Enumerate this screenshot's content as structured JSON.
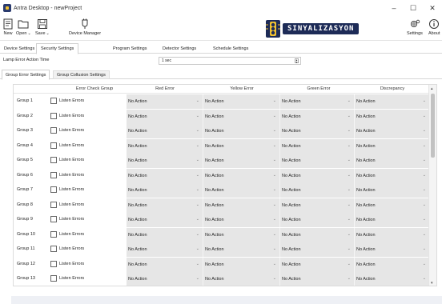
{
  "window": {
    "title": "Antra Desktop - newProject",
    "controls": {
      "minimize": "–",
      "maximize": "☐",
      "close": "✕"
    }
  },
  "toolbar": {
    "new_label": "New",
    "open_label": "Open",
    "save_label": "Save",
    "device_manager_label": "Device Manager",
    "logo_text": "SINYALIZASYON",
    "settings_label": "Settings",
    "about_label": "About",
    "caret": "⌄"
  },
  "tabs": [
    {
      "label": "Device Settings"
    },
    {
      "label": "Security Settings"
    },
    {
      "label": "Program Settings"
    },
    {
      "label": "Detector Settings"
    },
    {
      "label": "Schedule Settings"
    }
  ],
  "lamp_error": {
    "label": "Lamp Error Action Time",
    "value": "1 sec"
  },
  "subtabs": [
    {
      "label": "Group Error Settings"
    },
    {
      "label": "Group Collusion Settings"
    }
  ],
  "table": {
    "headers": [
      "Error Check Group",
      "Red Error",
      "Yellow Error",
      "Green Error",
      "Discrepancy"
    ],
    "checkbox_label": "Listen Errors",
    "rows": [
      {
        "group": "Group 1",
        "red": "No Action",
        "yellow": "No Action",
        "green": "No Action",
        "discrepancy": "No Action"
      },
      {
        "group": "Group 2",
        "red": "No Action",
        "yellow": "No Action",
        "green": "No Action",
        "discrepancy": "No Action"
      },
      {
        "group": "Group 3",
        "red": "No Action",
        "yellow": "No Action",
        "green": "No Action",
        "discrepancy": "No Action"
      },
      {
        "group": "Group 4",
        "red": "No Action",
        "yellow": "No Action",
        "green": "No Action",
        "discrepancy": "No Action"
      },
      {
        "group": "Group 5",
        "red": "No Action",
        "yellow": "No Action",
        "green": "No Action",
        "discrepancy": "No Action"
      },
      {
        "group": "Group 6",
        "red": "No Action",
        "yellow": "No Action",
        "green": "No Action",
        "discrepancy": "No Action"
      },
      {
        "group": "Group 7",
        "red": "No Action",
        "yellow": "No Action",
        "green": "No Action",
        "discrepancy": "No Action"
      },
      {
        "group": "Group 8",
        "red": "No Action",
        "yellow": "No Action",
        "green": "No Action",
        "discrepancy": "No Action"
      },
      {
        "group": "Group 9",
        "red": "No Action",
        "yellow": "No Action",
        "green": "No Action",
        "discrepancy": "No Action"
      },
      {
        "group": "Group 10",
        "red": "No Action",
        "yellow": "No Action",
        "green": "No Action",
        "discrepancy": "No Action"
      },
      {
        "group": "Group 11",
        "red": "No Action",
        "yellow": "No Action",
        "green": "No Action",
        "discrepancy": "No Action"
      },
      {
        "group": "Group 12",
        "red": "No Action",
        "yellow": "No Action",
        "green": "No Action",
        "discrepancy": "No Action"
      },
      {
        "group": "Group 13",
        "red": "No Action",
        "yellow": "No Action",
        "green": "No Action",
        "discrepancy": "No Action"
      },
      {
        "group": "Group 14",
        "red": "No Action",
        "yellow": "No Action",
        "green": "No Action",
        "discrepancy": "No Action"
      }
    ]
  },
  "colors": {
    "logo_bg": "#1d2b57",
    "dropdown_bg": "#e6e6e6",
    "border": "#d0d0d0"
  }
}
